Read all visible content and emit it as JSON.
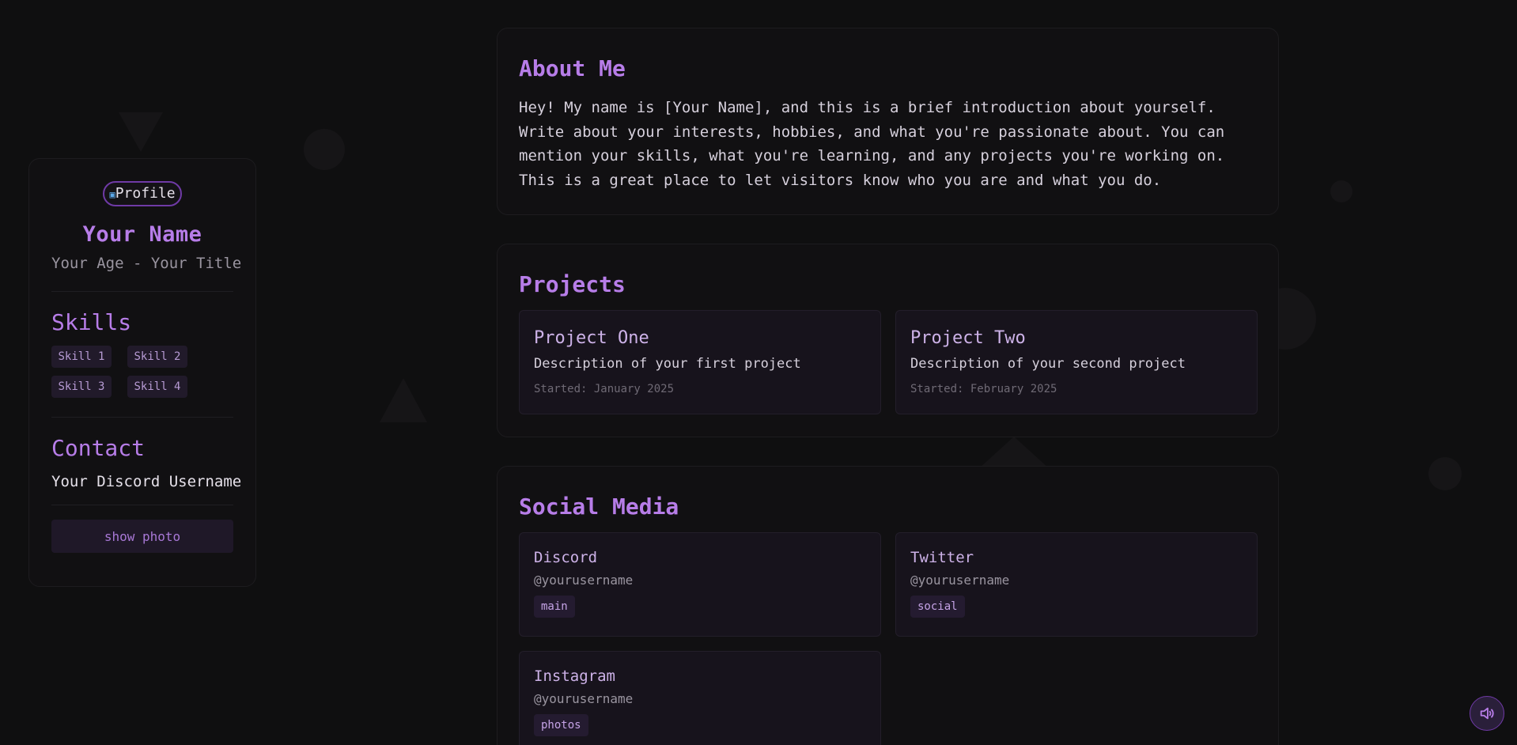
{
  "sidebar": {
    "avatar_alt": "Profile",
    "name": "Your Name",
    "subtitle": "Your Age - Your Title",
    "skills_title": "Skills",
    "skills": [
      "Skill 1",
      "Skill 2",
      "Skill 3",
      "Skill 4"
    ],
    "contact_title": "Contact",
    "contact_value": "Your Discord Username",
    "show_photo_label": "show photo"
  },
  "about": {
    "title": "About Me",
    "text": "Hey! My name is [Your Name], and this is a brief introduction about yourself. Write about your interests, hobbies, and what you're passionate about. You can mention your skills, what you're learning, and any projects you're working on. This is a great place to let visitors know who you are and what you do."
  },
  "projects": {
    "title": "Projects",
    "items": [
      {
        "name": "Project One",
        "description": "Description of your first project",
        "started": "Started: January 2025"
      },
      {
        "name": "Project Two",
        "description": "Description of your second project",
        "started": "Started: February 2025"
      }
    ]
  },
  "social": {
    "title": "Social Media",
    "items": [
      {
        "name": "Discord",
        "handle": "@yourusername",
        "tag": "main"
      },
      {
        "name": "Twitter",
        "handle": "@yourusername",
        "tag": "social"
      },
      {
        "name": "Instagram",
        "handle": "@yourusername",
        "tag": "photos"
      }
    ]
  },
  "icons": {
    "audio_button": "speaker-icon",
    "avatar": "broken-image-icon"
  },
  "colors": {
    "background": "#0f0f10",
    "accent": "#b77de8",
    "card_border": "#1d1c1f",
    "tag_bg": "#241b30"
  }
}
